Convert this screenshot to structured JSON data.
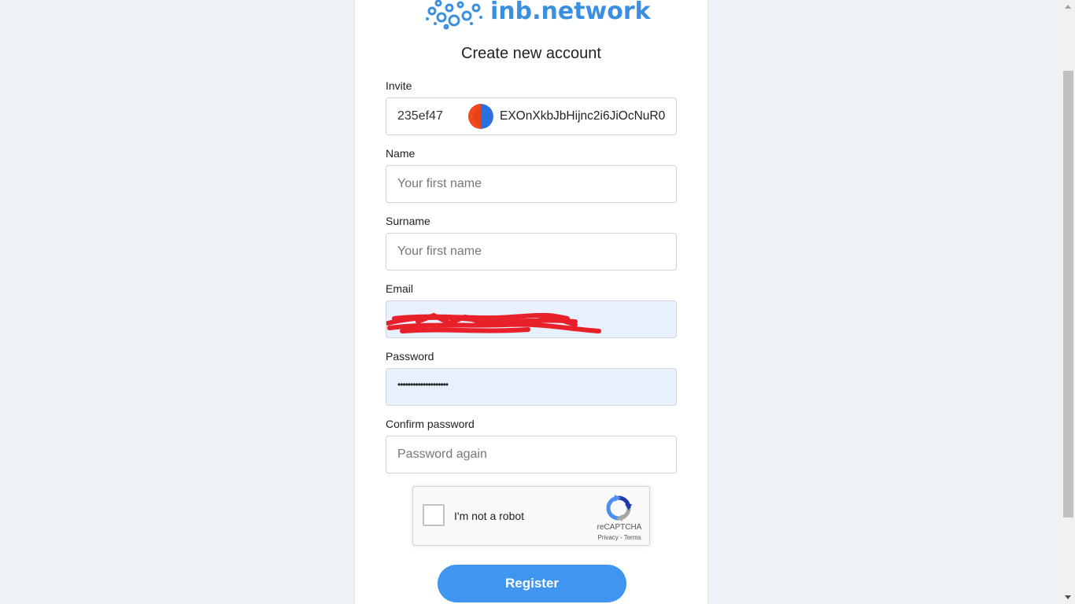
{
  "brand": {
    "name": "inb.network",
    "accent_color": "#3a8fe0"
  },
  "form": {
    "title": "Create new account",
    "invite": {
      "label": "Invite",
      "code": "235ef47",
      "token": "EXOnXkbJbHijnc2i6JiOcNuR0",
      "avatar_colors": [
        "#f04a1c",
        "#2a6fe0"
      ]
    },
    "name": {
      "label": "Name",
      "placeholder": "Your first name",
      "value": ""
    },
    "surname": {
      "label": "Surname",
      "placeholder": "Your first name",
      "value": ""
    },
    "email": {
      "label": "Email",
      "value": "",
      "redacted": true
    },
    "password": {
      "label": "Password",
      "masked_value": "••••••••••••••••••••"
    },
    "confirm_password": {
      "label": "Confirm password",
      "placeholder": "Password again",
      "value": ""
    },
    "captcha": {
      "label": "I'm not a robot",
      "brand": "reCAPTCHA",
      "links": "Privacy - Terms",
      "checked": false
    },
    "register_label": "Register",
    "register_color": "#3f95f0"
  }
}
